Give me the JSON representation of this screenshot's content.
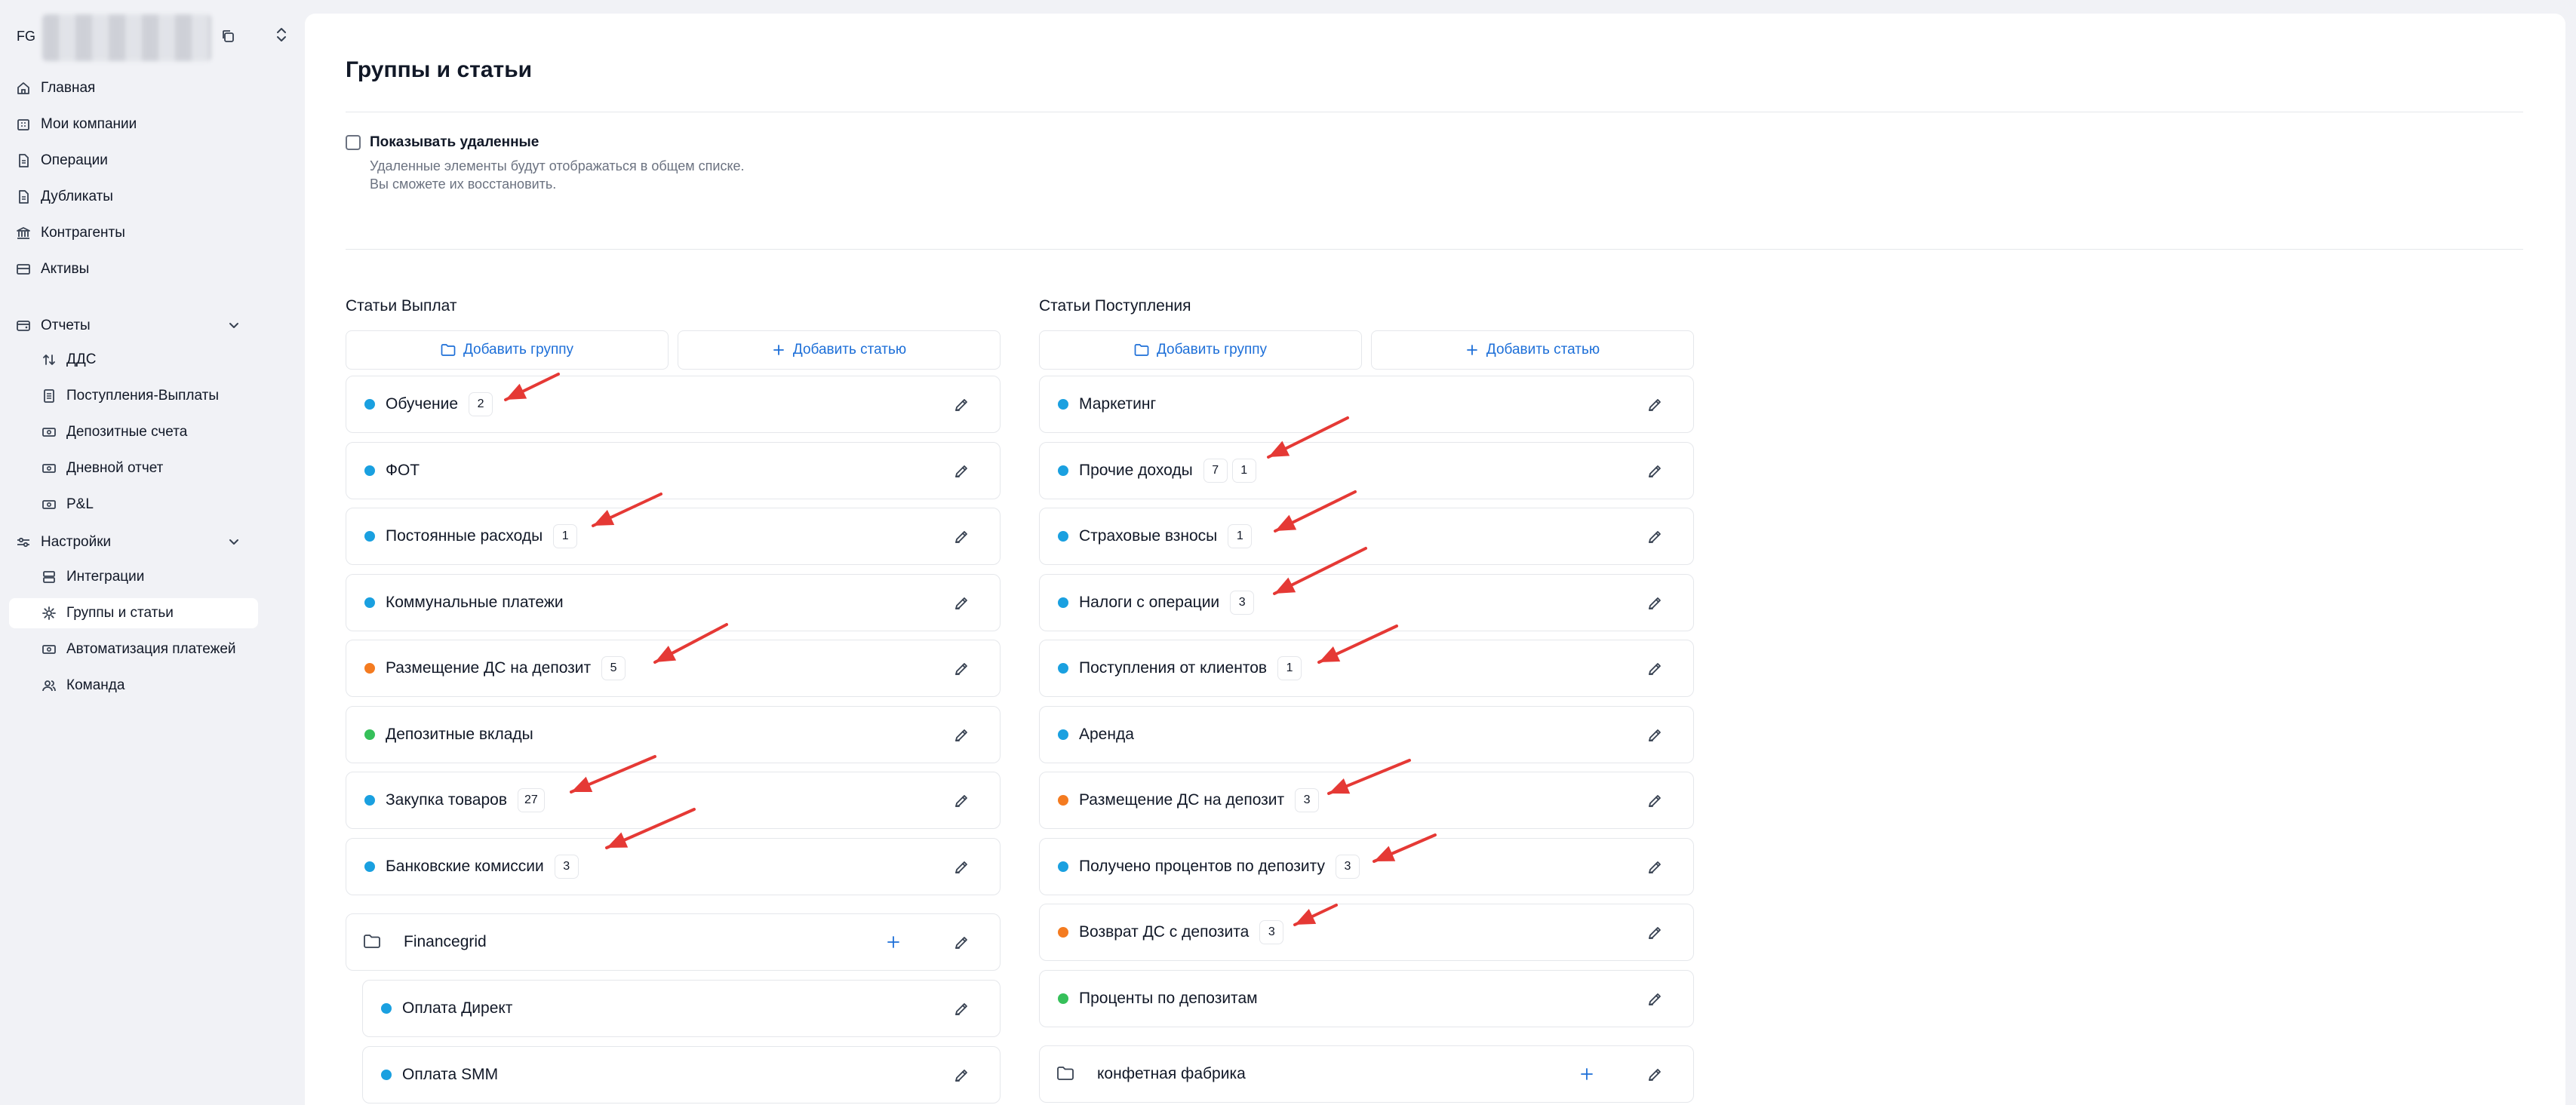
{
  "workspace": {
    "initials": "FG"
  },
  "nav": {
    "home": "Главная",
    "companies": "Мои компании",
    "operations": "Операции",
    "duplicates": "Дубликаты",
    "counterparties": "Контрагенты",
    "assets": "Активы",
    "reports": "Отчеты",
    "dds": "ДДС",
    "income_expense": "Поступления-Выплаты",
    "deposit_accounts": "Депозитные счета",
    "daily_report": "Дневной отчет",
    "pnl": "P&L",
    "settings": "Настройки",
    "integrations": "Интеграции",
    "groups": "Группы и статьи",
    "automation": "Автоматизация платежей",
    "team": "Команда"
  },
  "page": {
    "title": "Группы и статьи",
    "show_deleted_label": "Показывать удаленные",
    "hint_line1": "Удаленные элементы будут отображаться в общем списке.",
    "hint_line2": "Вы сможете их восстановить."
  },
  "colors": {
    "blue": "#1aa0e0",
    "orange": "#f47b20",
    "green": "#36c05a",
    "accent": "#1d6fd8",
    "arrow": "#e53935"
  },
  "expenses": {
    "title": "Статьи Выплат",
    "add_group": "Добавить группу",
    "add_article": "Добавить статью",
    "items": [
      {
        "label": "Обучение",
        "color": "blue",
        "badges": [
          "2"
        ]
      },
      {
        "label": "ФОТ",
        "color": "blue",
        "badges": []
      },
      {
        "label": "Постоянные расходы",
        "color": "blue",
        "badges": [
          "1"
        ]
      },
      {
        "label": "Коммунальные платежи",
        "color": "blue",
        "badges": []
      },
      {
        "label": "Размещение ДС на депозит",
        "color": "orange",
        "badges": [
          "5"
        ]
      },
      {
        "label": "Депозитные вклады",
        "color": "green",
        "badges": []
      },
      {
        "label": "Закупка товаров",
        "color": "blue",
        "badges": [
          "27"
        ]
      },
      {
        "label": "Банковские комиссии",
        "color": "blue",
        "badges": [
          "3"
        ]
      }
    ],
    "group": {
      "label": "Financegrid",
      "children": [
        {
          "label": "Оплата Директ",
          "color": "blue"
        },
        {
          "label": "Оплата SMM",
          "color": "blue"
        }
      ]
    }
  },
  "income": {
    "title": "Статьи Поступления",
    "add_group": "Добавить группу",
    "add_article": "Добавить статью",
    "items": [
      {
        "label": "Маркетинг",
        "color": "blue",
        "badges": []
      },
      {
        "label": "Прочие доходы",
        "color": "blue",
        "badges": [
          "7",
          "1"
        ]
      },
      {
        "label": "Страховые взносы",
        "color": "blue",
        "badges": [
          "1"
        ]
      },
      {
        "label": "Налоги с операции",
        "color": "blue",
        "badges": [
          "3"
        ]
      },
      {
        "label": "Поступления от клиентов",
        "color": "blue",
        "badges": [
          "1"
        ]
      },
      {
        "label": "Аренда",
        "color": "blue",
        "badges": []
      },
      {
        "label": "Размещение ДС на депозит",
        "color": "orange",
        "badges": [
          "3"
        ]
      },
      {
        "label": "Получено процентов по депозиту",
        "color": "blue",
        "badges": [
          "3"
        ]
      },
      {
        "label": "Возврат ДС с депозита",
        "color": "orange",
        "badges": [
          "3"
        ]
      },
      {
        "label": "Проценты по депозитам",
        "color": "green",
        "badges": []
      }
    ],
    "group": {
      "label": "конфетная фабрика"
    }
  }
}
